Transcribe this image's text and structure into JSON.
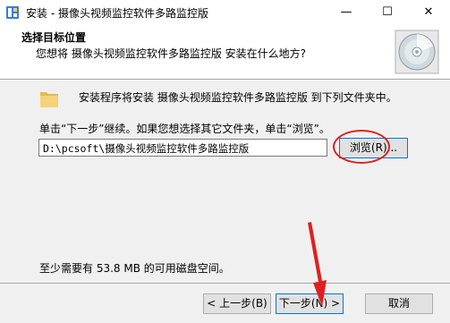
{
  "window": {
    "title": "安装 - 摄像头视频监控软件多路监控版",
    "minimize_glyph": "—",
    "maximize_glyph": "☐",
    "close_glyph": "✕",
    "app_icon": "installer-icon"
  },
  "header": {
    "title": "选择目标位置",
    "subtitle": "您想将 摄像头视频监控软件多路监控版 安装在什么地方?",
    "icon": "cd-disc-icon"
  },
  "body": {
    "folder_icon": "folder-icon",
    "info": "安装程序将安装 摄像头视频监控软件多路监控版 到下列文件夹中。",
    "hint": "单击“下一步”继续。如果您想选择其它文件夹，单击“浏览”。",
    "path_value": "D:\\pcsoft\\摄像头视频监控软件多路监控版",
    "browse_label": "浏览(R)...",
    "space_required": "至少需要有 53.8 MB 的可用磁盘空间。"
  },
  "footer": {
    "back_label": "< 上一步(B)",
    "next_label": "下一步(N) >",
    "cancel_label": "取消"
  },
  "annotations": {
    "highlight_color": "#e02020"
  }
}
